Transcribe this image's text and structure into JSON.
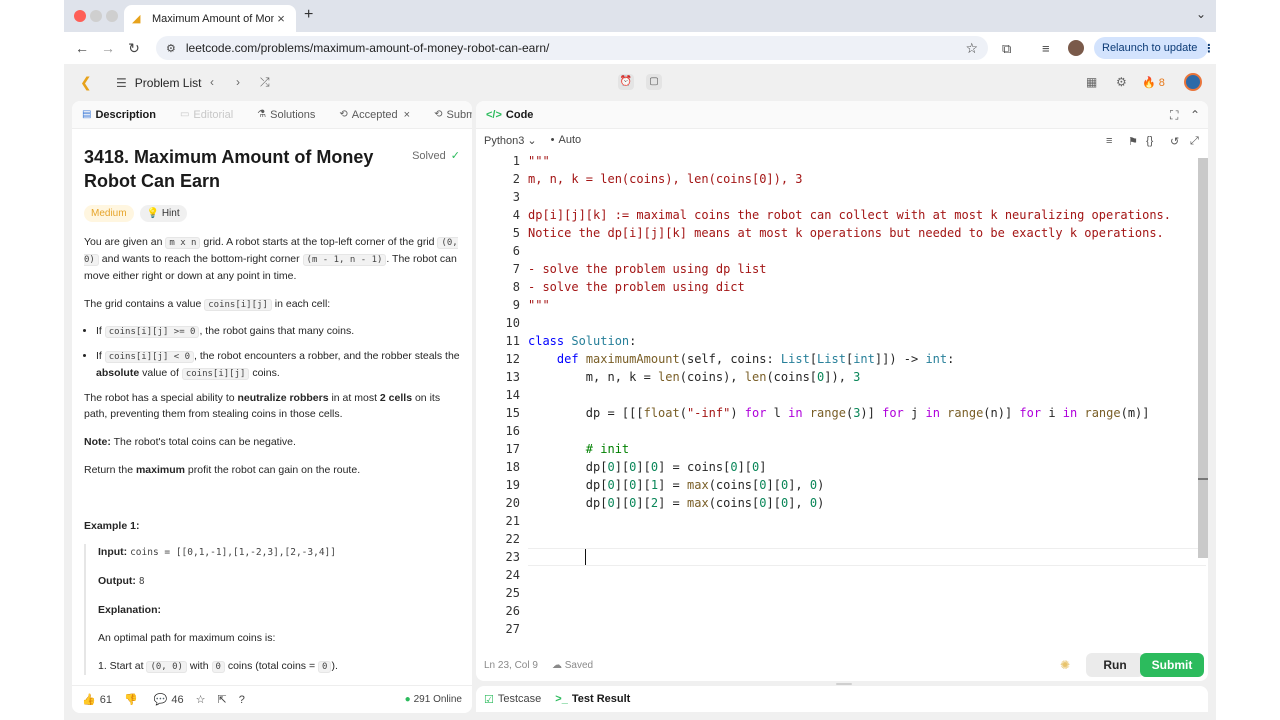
{
  "browser": {
    "tab_title": "Maximum Amount of Money R",
    "url": "leetcode.com/problems/maximum-amount-of-money-robot-can-earn/",
    "relaunch_label": "Relaunch to update"
  },
  "header": {
    "problem_list_label": "Problem List",
    "streak_count": "8"
  },
  "left_tabs": {
    "description": "Description",
    "editorial": "Editorial",
    "solutions": "Solutions",
    "accepted": "Accepted",
    "submissions": "Submissio"
  },
  "problem": {
    "title": "3418. Maximum Amount of Money Robot Can Earn",
    "status": "Solved",
    "difficulty": "Medium",
    "hint_label": "Hint",
    "p1": {
      "a": "You are given an",
      "c1": "m x n",
      "b": "grid. A robot starts at the top-left corner of the grid",
      "c2": "(0, 0)",
      "c": "and wants to reach the bottom-right corner",
      "c3": "(m - 1, n - 1)",
      "d": ". The robot can move either right or down at any point in time."
    },
    "p2": {
      "a": "The grid contains a value",
      "c1": "coins[i][j]",
      "b": "in each cell:"
    },
    "bullet1": {
      "a": "If",
      "c1": "coins[i][j] >= 0",
      "b": ", the robot gains that many coins."
    },
    "bullet2": {
      "a": "If",
      "c1": "coins[i][j] < 0",
      "b": ", the robot encounters a robber, and the robber steals the",
      "bold": "absolute",
      "c": "value of",
      "c2": "coins[i][j]",
      "d": "coins."
    },
    "p3": {
      "a": "The robot has a special ability to",
      "b1": "neutralize robbers",
      "b": "in at most",
      "b2": "2 cells",
      "c": "on its path, preventing them from stealing coins in those cells."
    },
    "note": {
      "label": "Note:",
      "text": "The robot's total coins can be negative."
    },
    "p4": {
      "a": "Return the",
      "bold": "maximum",
      "b": "profit the robot can gain on the route."
    },
    "example": {
      "heading": "Example 1:",
      "input_label": "Input:",
      "input_value": "coins = [[0,1,-1],[1,-2,3],[2,-3,4]]",
      "output_label": "Output:",
      "output_value": "8",
      "explanation_label": "Explanation:",
      "explanation_text": "An optimal path for maximum coins is:",
      "step1": {
        "a": "1. Start at",
        "c1": "(0, 0)",
        "b": "with",
        "c2": "0",
        "c": "coins (total coins =",
        "c3": "0",
        "d": ")."
      }
    }
  },
  "left_footer": {
    "likes": "61",
    "comments": "46",
    "online": "291 Online"
  },
  "code_panel": {
    "title": "Code",
    "language": "Python3",
    "auto_label": "Auto",
    "status": "Ln 23, Col 9",
    "saved": "Saved",
    "run_label": "Run",
    "submit_label": "Submit"
  },
  "bottom_tabs": {
    "testcase": "Testcase",
    "test_result": "Test Result"
  },
  "code": {
    "line_numbers": [
      "1",
      "2",
      "3",
      "4",
      "5",
      "6",
      "7",
      "8",
      "9",
      "10",
      "11",
      "12",
      "13",
      "14",
      "15",
      "16",
      "17",
      "18",
      "19",
      "20",
      "21",
      "22",
      "23",
      "24",
      "25",
      "26",
      "27"
    ],
    "l1": "\"\"\"",
    "l2": "m, n, k = len(coins), len(coins[0]), 3",
    "l4": "dp[i][j][k] := maximal coins the robot can collect with at most k neuralizing operations.",
    "l5": "Notice the dp[i][j][k] means at most k operations but needed to be exactly k operations.",
    "l7": "- solve the problem using dp list",
    "l8": "- solve the problem using dict",
    "l9": "\"\"\"",
    "l11": {
      "kw": "class",
      "name": "Solution",
      "end": ":"
    },
    "l12": {
      "indent": "    ",
      "kw": "def",
      "fn": "maximumAmount",
      "a": "(self, coins: ",
      "t1": "List",
      "b": "[",
      "t2": "List",
      "c": "[",
      "t3": "int",
      "d": "]]) -> ",
      "t4": "int",
      "e": ":"
    },
    "l13": {
      "indent": "        ",
      "a": "m, n, k = ",
      "f1": "len",
      "b": "(coins), ",
      "f2": "len",
      "c": "(coins[",
      "n1": "0",
      "d": "]), ",
      "n2": "3"
    },
    "l15": {
      "indent": "        ",
      "a": "dp = [[[",
      "f1": "float",
      "b": "(",
      "s": "\"-inf\"",
      "c": ") ",
      "k1": "for",
      "d": " l ",
      "k2": "in",
      "e": " ",
      "f2": "range",
      "f": "(",
      "n1": "3",
      "g": ")] ",
      "k3": "for",
      "h": " j ",
      "k4": "in",
      "i": " ",
      "f3": "range",
      "j": "(n)] ",
      "k5": "for",
      "k": " i ",
      "k6": "in",
      "l": " ",
      "f4": "range",
      "m": "(m)]"
    },
    "l17": {
      "indent": "        ",
      "comment": "# init"
    },
    "l18": {
      "indent": "        ",
      "a": "dp[",
      "n1": "0",
      "b": "][",
      "n2": "0",
      "c": "][",
      "n3": "0",
      "d": "] = coins[",
      "n4": "0",
      "e": "][",
      "n5": "0",
      "f": "]"
    },
    "l19": {
      "indent": "        ",
      "a": "dp[",
      "n1": "0",
      "b": "][",
      "n2": "0",
      "c": "][",
      "n3": "1",
      "d": "] = ",
      "f1": "max",
      "e": "(coins[",
      "n4": "0",
      "f": "][",
      "n5": "0",
      "g": "], ",
      "n6": "0",
      "h": ")"
    },
    "l20": {
      "indent": "        ",
      "a": "dp[",
      "n1": "0",
      "b": "][",
      "n2": "0",
      "c": "][",
      "n3": "2",
      "d": "] = ",
      "f1": "max",
      "e": "(coins[",
      "n4": "0",
      "f": "][",
      "n5": "0",
      "g": "], ",
      "n6": "0",
      "h": ")"
    }
  },
  "colors": {
    "accent_green": "#2cbb5d",
    "medium_badge": "#e6a52c",
    "brand_orange": "#e7a21b"
  }
}
